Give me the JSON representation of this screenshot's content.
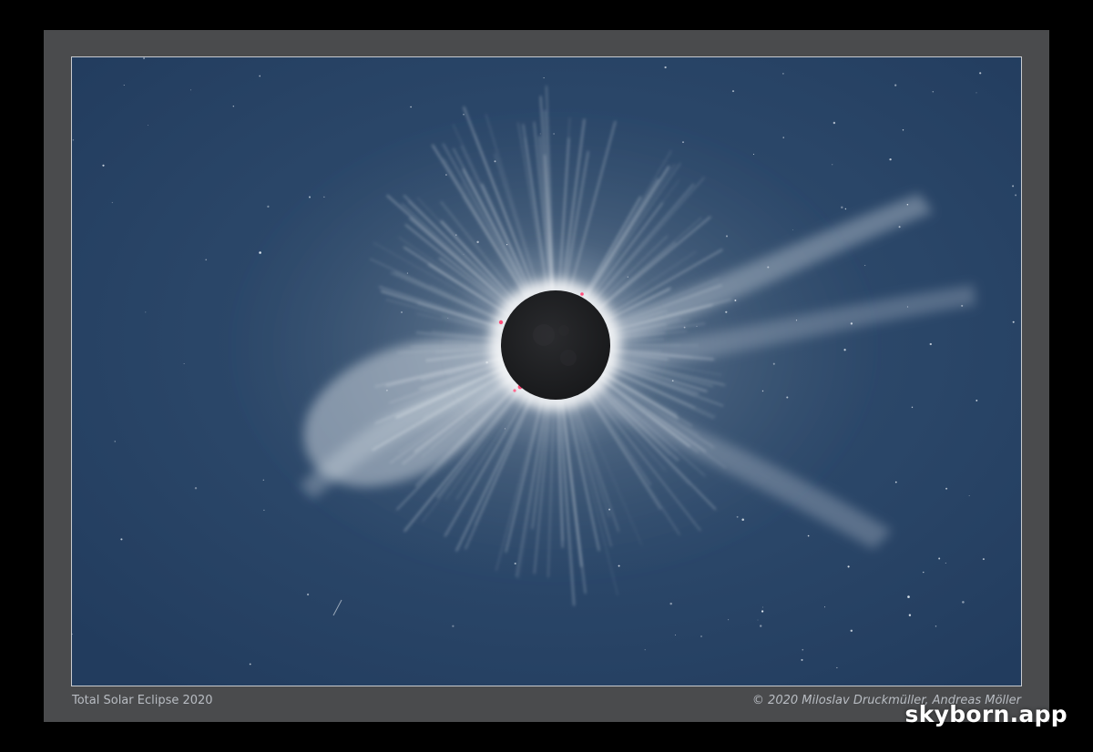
{
  "photo": {
    "caption_title": "Total Solar Eclipse 2020",
    "credit": "© 2020 Miloslav Druckmüller, Andreas Möller",
    "subject": "solar-eclipse-corona"
  },
  "watermark": {
    "text": "skyborn.app"
  },
  "colors": {
    "page_background": "#000000",
    "mat": "#4a4b4d",
    "sky": "#284468",
    "corona": "#e8ebee",
    "moon_disk": "#1e1f22",
    "prominence": "#ff4e7a"
  }
}
